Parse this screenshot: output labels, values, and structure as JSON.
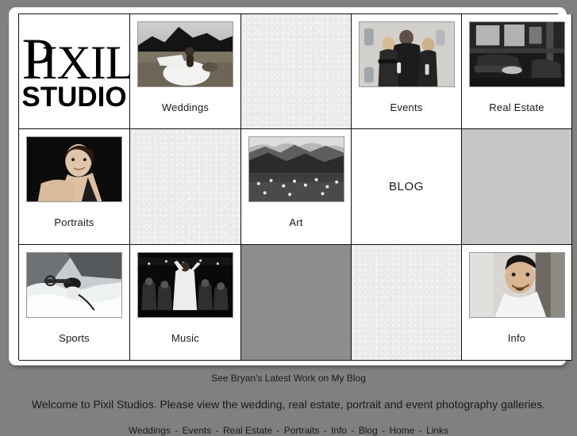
{
  "site": {
    "logo": {
      "word_initial": "P",
      "word_rest": "IXIL",
      "word_full": "PIXIL",
      "subtitle": "STUDIO"
    },
    "background_color": "#808080",
    "frame_color": "#ffffff",
    "grid_line_color": "#111111"
  },
  "grid": {
    "columns": 5,
    "rows": 3,
    "cells": [
      {
        "id": "logo",
        "kind": "logo",
        "label": "",
        "row": 1,
        "col": 1
      },
      {
        "id": "weddings",
        "kind": "photo",
        "label": "Weddings",
        "row": 1,
        "col": 2,
        "image": "bride-in-field-photo"
      },
      {
        "id": "blank-r1c3",
        "kind": "dots",
        "label": "",
        "row": 1,
        "col": 3
      },
      {
        "id": "events",
        "kind": "photo",
        "label": "Events",
        "row": 1,
        "col": 4,
        "image": "party-group-photo"
      },
      {
        "id": "real-estate",
        "kind": "photo",
        "label": "Real Estate",
        "row": 1,
        "col": 5,
        "image": "interior-lounge-photo"
      },
      {
        "id": "portraits",
        "kind": "photo",
        "label": "Portraits",
        "row": 2,
        "col": 1,
        "image": "woman-portrait-photo"
      },
      {
        "id": "blank-r2c2",
        "kind": "dots",
        "label": "",
        "row": 2,
        "col": 2
      },
      {
        "id": "art",
        "kind": "photo",
        "label": "Art",
        "row": 2,
        "col": 3,
        "image": "mountain-meadow-photo"
      },
      {
        "id": "blog",
        "kind": "text",
        "label": "BLOG",
        "row": 2,
        "col": 4
      },
      {
        "id": "blank-r2c5",
        "kind": "light",
        "label": "",
        "row": 2,
        "col": 5
      },
      {
        "id": "sports",
        "kind": "photo",
        "label": "Sports",
        "row": 3,
        "col": 1,
        "image": "kayaker-whitewater-photo"
      },
      {
        "id": "music",
        "kind": "photo",
        "label": "Music",
        "row": 3,
        "col": 2,
        "image": "concert-crowd-photo"
      },
      {
        "id": "blank-r3c3",
        "kind": "mid",
        "label": "",
        "row": 3,
        "col": 3
      },
      {
        "id": "blank-r3c4",
        "kind": "dots",
        "label": "",
        "row": 3,
        "col": 4
      },
      {
        "id": "info",
        "kind": "photo",
        "label": "Info",
        "row": 3,
        "col": 5,
        "image": "man-portrait-photo"
      }
    ]
  },
  "footer": {
    "blog_promo": "See Bryan's Latest Work on My Blog",
    "welcome": "Welcome to Pixil Studios. Please view the wedding, real estate, portrait and event photography galleries.",
    "nav": [
      "Weddings",
      "Events",
      "Real Estate",
      "Portraits",
      "Info",
      "Blog",
      "Home",
      "Links"
    ],
    "nav_separator": "-"
  }
}
